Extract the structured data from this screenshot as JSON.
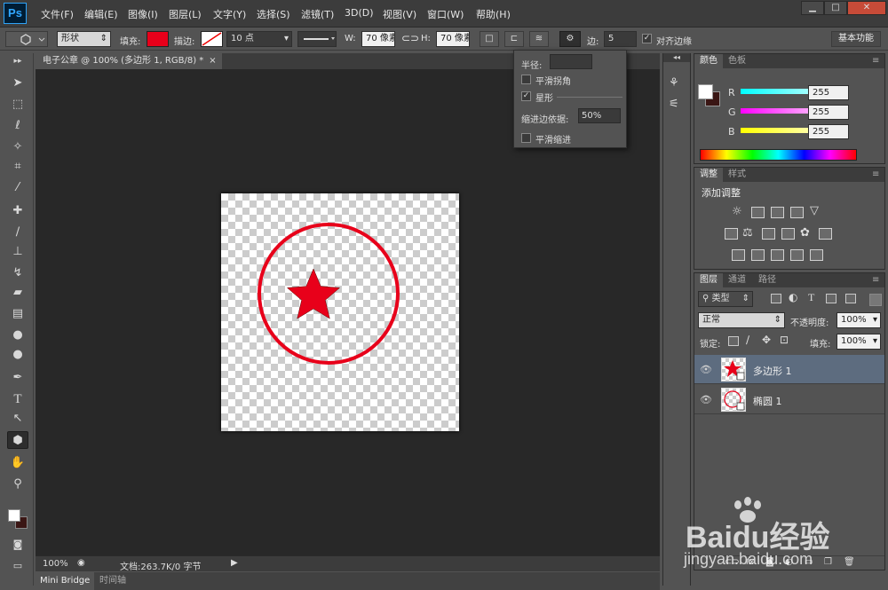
{
  "app": {
    "logo": "Ps",
    "window_buttons": [
      "▁",
      "□",
      "✕"
    ]
  },
  "menu": [
    "文件(F)",
    "编辑(E)",
    "图像(I)",
    "图层(L)",
    "文字(Y)",
    "选择(S)",
    "滤镜(T)",
    "3D(D)",
    "视图(V)",
    "窗口(W)",
    "帮助(H)"
  ],
  "options": {
    "mode": "形状",
    "fill_label": "填充:",
    "fill_color": "#e8001a",
    "stroke_label": "描边:",
    "stroke_width": "10 点",
    "w_label": "W:",
    "w_value": "70 像素",
    "h_label": "H:",
    "h_value": "70 像素",
    "sides_label": "边:",
    "sides_value": "5",
    "align_edges": "对齐边缘",
    "workspace": "基本功能"
  },
  "popup": {
    "radius_label": "半径:",
    "radius_value": "",
    "smooth_corners": "平滑拐角",
    "star": "星形",
    "indent_label": "缩进边依据:",
    "indent_value": "50%",
    "smooth_indent": "平滑缩进"
  },
  "document": {
    "tab_title": "电子公章 @ 100% (多边形 1, RGB/8) *",
    "zoom": "100%",
    "doc_info": "文档:263.7K/0 字节"
  },
  "bottom_tabs": [
    "Mini Bridge",
    "时间轴"
  ],
  "color_panel": {
    "tabs": [
      "颜色",
      "色板"
    ],
    "r_label": "R",
    "g_label": "G",
    "b_label": "B",
    "r": "255",
    "g": "255",
    "b": "255"
  },
  "adjust_panel": {
    "tabs": [
      "调整",
      "样式"
    ],
    "title": "添加调整"
  },
  "layers_panel": {
    "tabs": [
      "图层",
      "通道",
      "路径"
    ],
    "filter": "类型",
    "blend": "正常",
    "opacity_label": "不透明度:",
    "opacity": "100%",
    "lock_label": "锁定:",
    "fill_label": "填充:",
    "fill": "100%",
    "layers": [
      {
        "name": "多边形 1",
        "selected": true
      },
      {
        "name": "椭圆 1",
        "selected": false
      }
    ]
  },
  "watermark": {
    "brand": "Baidu经验",
    "url": "jingyan.baidu.com"
  },
  "colors": {
    "accent_red": "#e8001a",
    "selected_layer": "#5d6c7f"
  }
}
